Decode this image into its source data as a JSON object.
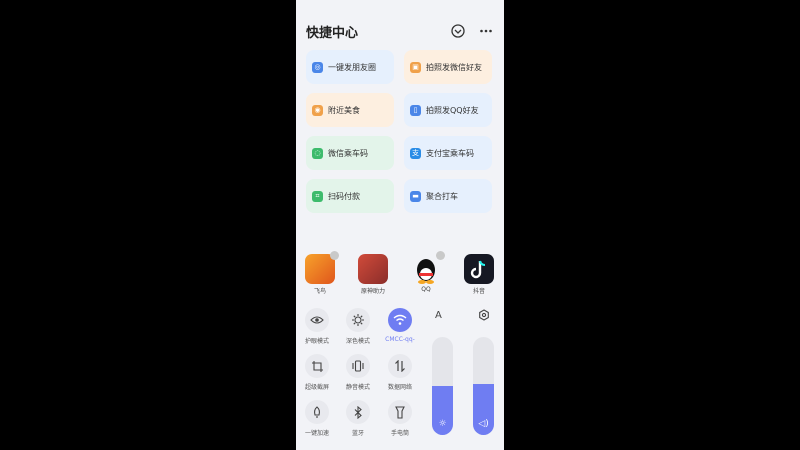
{
  "header": {
    "title": "快捷中心"
  },
  "shortcuts": [
    {
      "label": "一键发朋友圈"
    },
    {
      "label": "拍照发微信好友"
    },
    {
      "label": "附近美食"
    },
    {
      "label": "拍照发QQ好友"
    },
    {
      "label": "微信乘车码"
    },
    {
      "label": "支付宝乘车码"
    },
    {
      "label": "扫码付款"
    },
    {
      "label": "聚合打车"
    }
  ],
  "apps": [
    {
      "label": "飞鸟"
    },
    {
      "label": "原神助力"
    },
    {
      "label": "QQ"
    },
    {
      "label": "抖音"
    }
  ],
  "controls": [
    {
      "label": "护眼模式"
    },
    {
      "label": "深色模式"
    },
    {
      "label": "CMCC-qq-"
    },
    {
      "label": "超级截屏"
    },
    {
      "label": "静音模式"
    },
    {
      "label": "数据网络"
    },
    {
      "label": "一键加速"
    },
    {
      "label": "蓝牙"
    },
    {
      "label": "手电筒"
    }
  ],
  "sliders": {
    "brightness": 0.5,
    "volume": 0.52,
    "font_label": "A"
  },
  "colors": {
    "accent": "#6f7df2"
  }
}
